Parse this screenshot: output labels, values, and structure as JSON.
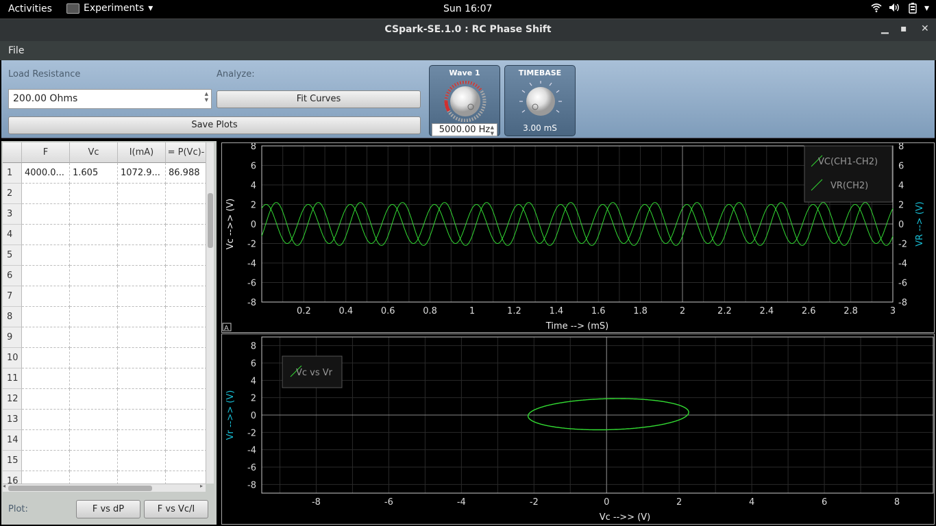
{
  "topbar": {
    "activities": "Activities",
    "app_menu": "Experiments",
    "clock": "Sun 16:07"
  },
  "window": {
    "title": "CSpark-SE.1.0 : RC Phase Shift",
    "menu": [
      "File"
    ]
  },
  "controls": {
    "load_resistance_label": "Load Resistance",
    "load_resistance_value": "200.00 Ohms",
    "analyze_label": "Analyze:",
    "fit_curves": "Fit Curves",
    "save_plots": "Save Plots",
    "wave1_title": "Wave 1",
    "wave1_value": "5000.00 Hz",
    "timebase_title": "TIMEBASE",
    "timebase_value": "3.00 mS",
    "wave1_level": 0.7,
    "timebase_level": 0.45
  },
  "table": {
    "headers": [
      "F",
      "Vc",
      "I(mA)",
      "= P(Vc)-"
    ],
    "row_numbers": [
      "1",
      "2",
      "3",
      "4",
      "5",
      "6",
      "7",
      "8",
      "9",
      "10",
      "11",
      "12",
      "13",
      "14",
      "15",
      "16"
    ],
    "rows": [
      [
        "4000.0...",
        "1.605",
        "1072.9...",
        "86.988"
      ]
    ]
  },
  "plot_buttons": {
    "label": "Plot:",
    "f_vs_dp": "F vs dP",
    "f_vs_vci": "F vs Vc/I"
  },
  "colors": {
    "trace": "#33dd33",
    "axis_cyan": "#18c0d8",
    "grid": "#2a2a2a"
  },
  "chart_data": [
    {
      "type": "line",
      "xlabel": "Time --> (mS)",
      "ylabel": "Vc -->> (V)",
      "ylabel_right": "VR --> (V)",
      "xlim": [
        0,
        3
      ],
      "ylim": [
        -8,
        8
      ],
      "x_ticks": [
        "0.2",
        "0.4",
        "0.6",
        "0.8",
        "1",
        "1.2",
        "1.4",
        "1.6",
        "1.8",
        "2",
        "2.2",
        "2.4",
        "2.6",
        "2.8",
        "3"
      ],
      "y_ticks": [
        "8",
        "6",
        "4",
        "2",
        "0",
        "-2",
        "-4",
        "-6",
        "-8"
      ],
      "legend": "top-right",
      "series": [
        {
          "name": "VC(CH1-CH2)",
          "amplitude": 2.2,
          "frequency_khz": 5.0,
          "phase_deg": 0
        },
        {
          "name": "VR(CH2)",
          "amplitude": 2.0,
          "frequency_khz": 5.0,
          "phase_deg": 87
        }
      ]
    },
    {
      "type": "scatter",
      "xlabel": "Vc -->> (V)",
      "ylabel": "Vr -->> (V)",
      "xlim": [
        -9.5,
        9
      ],
      "ylim": [
        -9,
        9
      ],
      "x_ticks": [
        "-8",
        "-6",
        "-4",
        "-2",
        "0",
        "2",
        "4",
        "6",
        "8"
      ],
      "y_ticks": [
        "8",
        "6",
        "4",
        "2",
        "0",
        "-2",
        "-4",
        "-6",
        "-8"
      ],
      "legend": "top-left",
      "series": [
        {
          "name": "Vc vs Vr",
          "vc_amplitude": 2.2,
          "vr_amplitude": 1.8,
          "center_x": 0.05,
          "center_y": 0.1,
          "phase_deg": 87
        }
      ]
    }
  ]
}
